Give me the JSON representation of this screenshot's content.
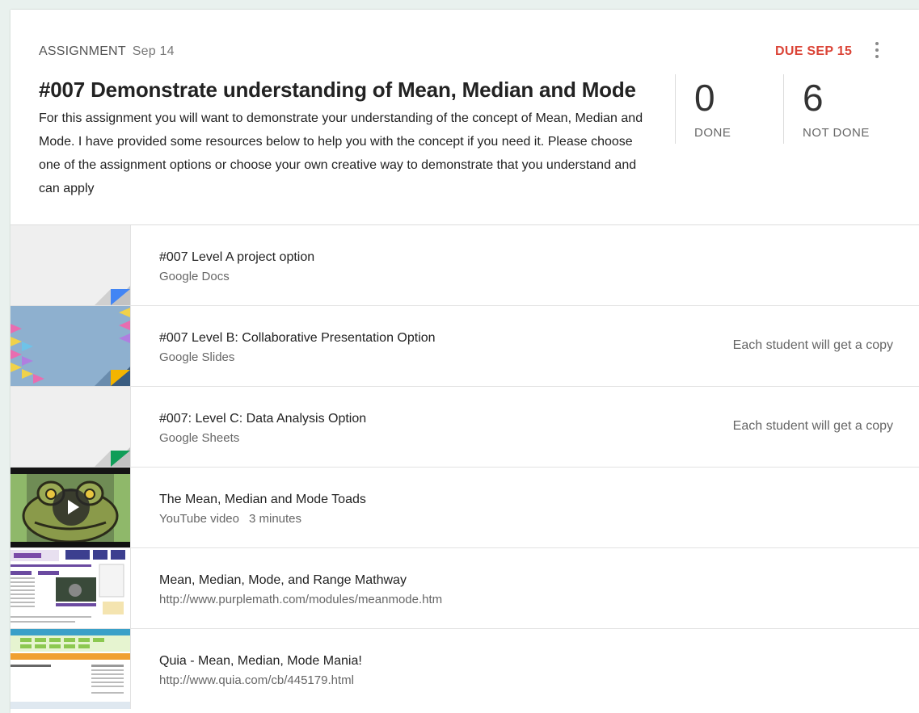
{
  "assignment": {
    "kind": "ASSIGNMENT",
    "posted": "Sep 14",
    "due": "DUE SEP 15",
    "title": "#007 Demonstrate understanding of Mean, Median and Mode",
    "description": "For this assignment you will want to demonstrate your understanding of the concept of Mean, Median and Mode. I have provided some resources below to help you with the concept if you need it. Please choose one of the assignment options or choose your own creative way to demonstrate that you understand and can apply",
    "done_count": "0",
    "done_label": "DONE",
    "not_done_count": "6",
    "not_done_label": "NOT DONE"
  },
  "materials": [
    {
      "title": "#007 Level A project option",
      "subtitle": "Google Docs",
      "note": "",
      "icon": "google-docs-icon",
      "color": "#4285f4"
    },
    {
      "title": "#007 Level B: Collaborative Presentation Option",
      "subtitle": "Google Slides",
      "note": "Each student will get a copy",
      "icon": "google-slides-icon",
      "color": "#f4b400"
    },
    {
      "title": "#007: Level C: Data Analysis Option",
      "subtitle": "Google Sheets",
      "note": "Each student will get a copy",
      "icon": "google-sheets-icon",
      "color": "#0f9d58"
    },
    {
      "title": "The Mean, Median and Mode Toads",
      "subtitle": "YouTube video",
      "duration": "3 minutes",
      "icon": "play-icon"
    },
    {
      "title": "Mean, Median, Mode, and Range Mathway",
      "subtitle": "http://www.purplemath.com/modules/meanmode.htm",
      "icon": "web-page-thumbnail"
    },
    {
      "title": "Quia - Mean, Median, Mode Mania!",
      "subtitle": "http://www.quia.com/cb/445179.html",
      "icon": "web-page-thumbnail"
    }
  ]
}
